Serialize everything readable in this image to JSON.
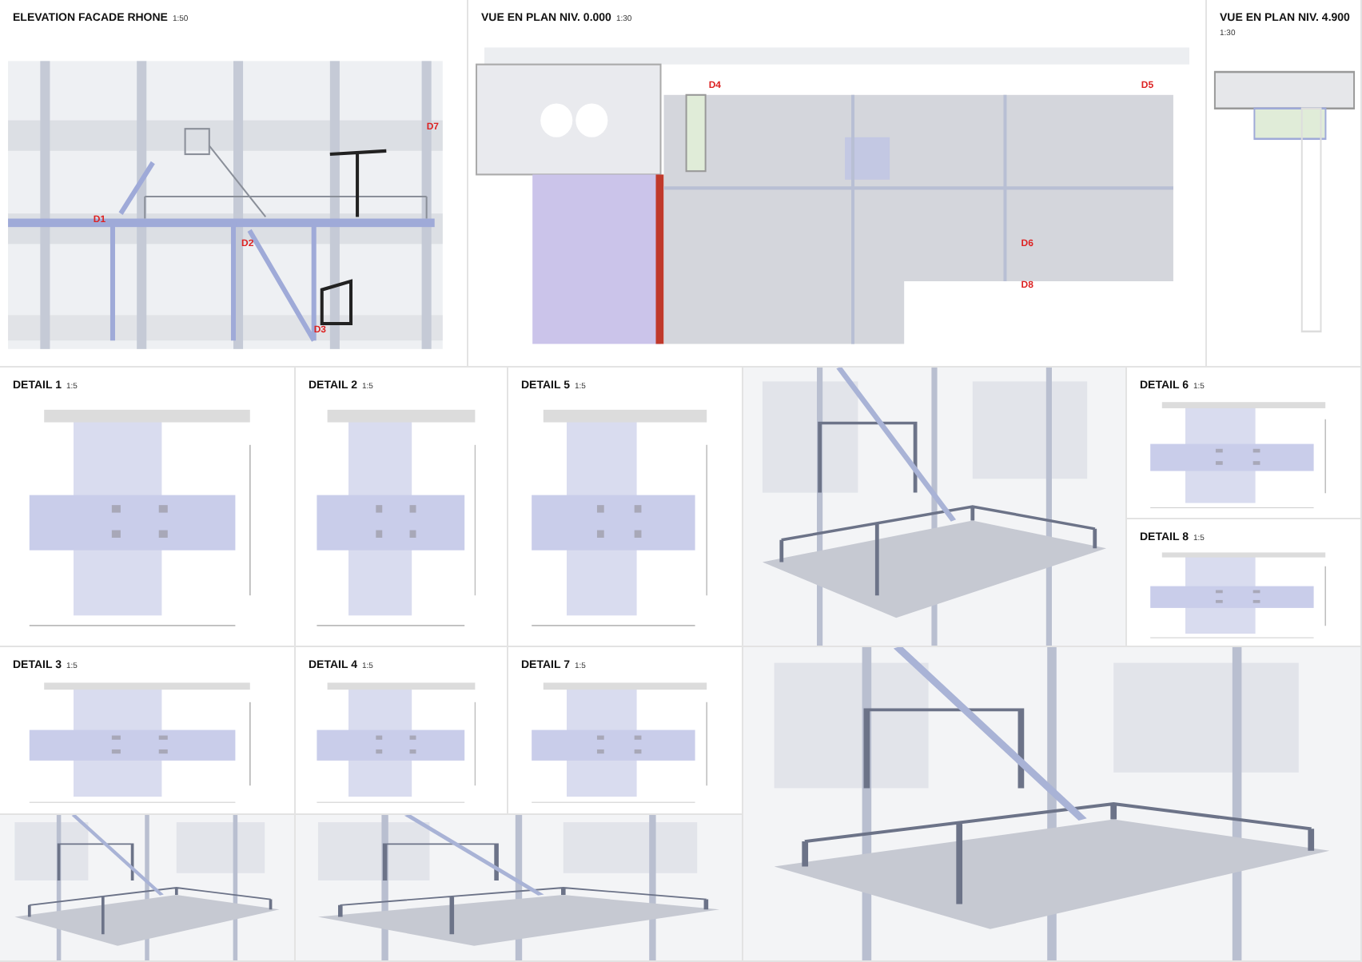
{
  "sheet": {
    "panels": [
      {
        "kind": "elevation",
        "title": "ELEVATION FACADE RHONE",
        "scale": "1:50",
        "markers": [
          "D1",
          "D2",
          "D3",
          "D7"
        ]
      },
      {
        "kind": "plan",
        "title": "VUE EN PLAN NIV. 0.000",
        "scale": "1:30",
        "markers": [
          "D4",
          "D5",
          "D6",
          "D8"
        ]
      },
      {
        "kind": "plan-small",
        "title": "VUE EN PLAN NIV. 4.900",
        "scale": "1:30"
      },
      {
        "kind": "detail",
        "title": "DETAIL 1",
        "scale": "1:5"
      },
      {
        "kind": "detail",
        "title": "DETAIL 2",
        "scale": "1:5"
      },
      {
        "kind": "detail",
        "title": "DETAIL 5",
        "scale": "1:5"
      },
      {
        "kind": "render"
      },
      {
        "kind": "detail",
        "title": "DETAIL 6",
        "scale": "1:5"
      },
      {
        "kind": "detail",
        "title": "DETAIL 8",
        "scale": "1:5"
      },
      {
        "kind": "detail",
        "title": "DETAIL 3",
        "scale": "1:5"
      },
      {
        "kind": "detail",
        "title": "DETAIL 4",
        "scale": "1:5"
      },
      {
        "kind": "detail",
        "title": "DETAIL 7",
        "scale": "1:5"
      },
      {
        "kind": "render"
      },
      {
        "kind": "render"
      },
      {
        "kind": "render"
      }
    ]
  }
}
